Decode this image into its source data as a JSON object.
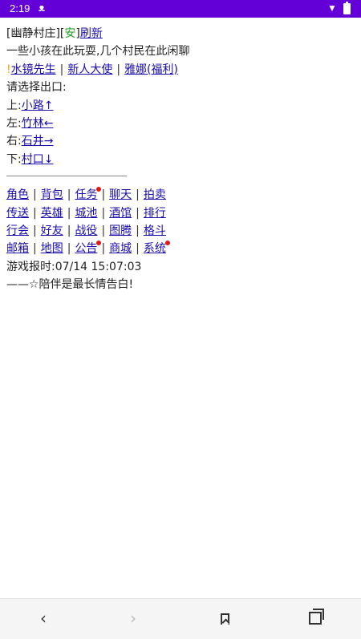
{
  "status_bar": {
    "time": "2:19",
    "notification_icon": "bug-icon",
    "wifi_icon": "wifi-icon",
    "battery_icon": "battery-icon",
    "color": "#6300d8"
  },
  "location": {
    "bracket_open": "[",
    "name": "幽静村庄",
    "bracket_mid": "][",
    "safe": "安",
    "bracket_close": "]",
    "refresh": "刷新"
  },
  "description": "一些小孩在此玩耍,几个村民在此闲聊",
  "npcs": {
    "marker": "!",
    "items": [
      "水镜先生",
      "新人大使",
      "雅娜(福利)"
    ],
    "separator": "|"
  },
  "exit_prompt": "请选择出口:",
  "exits": [
    {
      "direction": "上:",
      "label": "小路↑"
    },
    {
      "direction": "左:",
      "label": "竹林←"
    },
    {
      "direction": "右:",
      "label": "石井→"
    },
    {
      "direction": "下:",
      "label": "村口↓"
    }
  ],
  "menu": [
    [
      "角色",
      "背包",
      "任务",
      "聊天",
      "拍卖"
    ],
    [
      "传送",
      "英雄",
      "城池",
      "酒馆",
      "排行"
    ],
    [
      "行会",
      "好友",
      "战役",
      "图腾",
      "格斗"
    ],
    [
      "邮箱",
      "地图",
      "公告",
      "商城",
      "系统"
    ]
  ],
  "menu_separator": "|",
  "notification_dots": [
    "任务",
    "公告",
    "系统"
  ],
  "game_time": "游戏报时:07/14 15:07:03",
  "motto": "——☆陪伴是最长情告白!",
  "nav_bar": {
    "back": "‹",
    "forward": "›",
    "icons": [
      "back-icon",
      "forward-icon",
      "bookmark-icon",
      "tabs-icon"
    ]
  },
  "colors": {
    "link": "#1a0dab",
    "safe": "#1b9e1b",
    "marker": "#f2a500",
    "dot": "#e01818"
  }
}
